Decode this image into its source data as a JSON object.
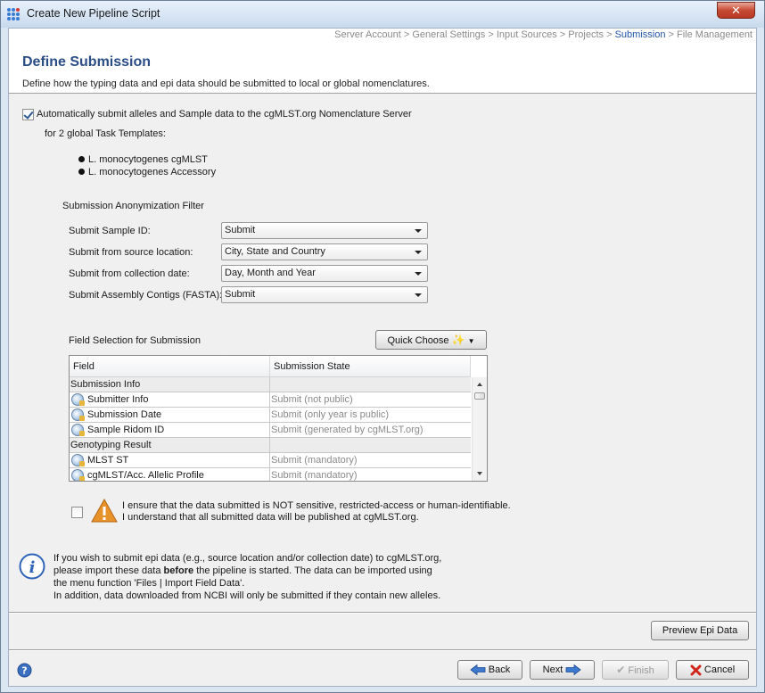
{
  "window": {
    "title": "Create New Pipeline Script",
    "close_label": "✕"
  },
  "breadcrumb": {
    "items": [
      "Server Account",
      "General Settings",
      "Input Sources",
      "Projects",
      "Submission",
      "File Management"
    ],
    "separator": ">",
    "active": "Submission"
  },
  "header": {
    "title": "Define Submission",
    "description": "Define how the typing data and epi data should be submitted to local or global nomenclatures."
  },
  "auto_submit": {
    "checked": true,
    "label": "Automatically submit alleles and Sample data to the cgMLST.org Nomenclature Server",
    "templates_heading": "for 2 global Task Templates:",
    "templates": [
      "L. monocytogenes cgMLST",
      "L. monocytogenes Accessory"
    ]
  },
  "anonymization": {
    "heading": "Submission Anonymization Filter",
    "rows": [
      {
        "label": "Submit Sample ID:",
        "value": "Submit"
      },
      {
        "label": "Submit from source location:",
        "value": "City, State and Country"
      },
      {
        "label": "Submit from collection date:",
        "value": "Day, Month and Year"
      },
      {
        "label": "Submit Assembly Contigs (FASTA):",
        "value": "Submit"
      }
    ]
  },
  "field_selection": {
    "heading": "Field Selection for Submission",
    "quick_choose_label": "Quick Choose",
    "columns": [
      "Field",
      "Submission State"
    ],
    "rows": [
      {
        "type": "group",
        "field": "Submission Info",
        "state": ""
      },
      {
        "type": "item",
        "field": "Submitter Info",
        "state": "Submit (not public)"
      },
      {
        "type": "item",
        "field": "Submission Date",
        "state": "Submit (only year is public)"
      },
      {
        "type": "item",
        "field": "Sample Ridom ID",
        "state": "Submit (generated by cgMLST.org)"
      },
      {
        "type": "group",
        "field": "Genotyping Result",
        "state": ""
      },
      {
        "type": "item",
        "field": "MLST ST",
        "state": "Submit (mandatory)"
      },
      {
        "type": "item",
        "field": "cgMLST/Acc. Allelic Profile",
        "state": "Submit (mandatory)"
      }
    ]
  },
  "consent": {
    "checked": false,
    "line1": "I ensure that the data submitted is NOT sensitive, restricted-access or human-identifiable.",
    "line2": "I understand that all submitted data will be published at cgMLST.org."
  },
  "info": {
    "line1": "If you wish to submit epi data (e.g., source location and/or collection date) to cgMLST.org,",
    "line2_pre": "please import these data ",
    "line2_bold": "before",
    "line2_post": " the pipeline is started. The data can be imported using",
    "line3": "the menu function 'Files | Import Field Data'.",
    "line4": "In addition, data downloaded from NCBI will only be submitted if they contain new alleles."
  },
  "preview_button": "Preview Epi Data",
  "footer": {
    "back": "Back",
    "next": "Next",
    "finish": "Finish",
    "cancel": "Cancel"
  },
  "colors": {
    "title_blue": "#2a4d86",
    "breadcrumb_active": "#2255aa",
    "close_red": "#c74a35"
  }
}
